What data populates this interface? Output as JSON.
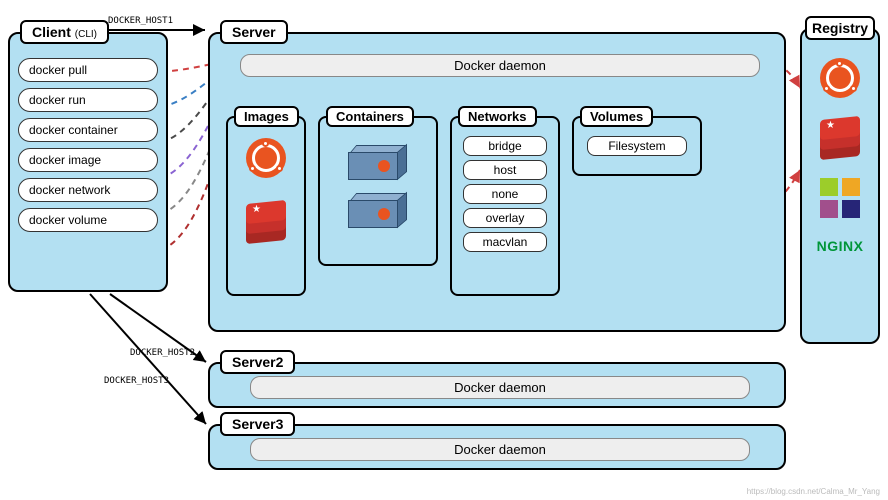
{
  "chart_data": {
    "type": "diagram",
    "nodes": {
      "client": {
        "title": "Client",
        "subtitle": "(CLI)",
        "commands": [
          "docker pull",
          "docker run",
          "docker container",
          "docker image",
          "docker network",
          "docker volume"
        ]
      },
      "server": {
        "title": "Server",
        "daemon": "Docker daemon",
        "images": {
          "title": "Images",
          "items": [
            "ubuntu",
            "redis"
          ]
        },
        "containers": {
          "title": "Containers",
          "items": [
            "container-1",
            "container-2"
          ]
        },
        "networks": {
          "title": "Networks",
          "items": [
            "bridge",
            "host",
            "none",
            "overlay",
            "macvlan"
          ]
        },
        "volumes": {
          "title": "Volumes",
          "items": [
            "Filesystem"
          ]
        }
      },
      "server2": {
        "title": "Server2",
        "daemon": "Docker daemon"
      },
      "server3": {
        "title": "Server3",
        "daemon": "Docker daemon"
      },
      "registry": {
        "title": "Registry",
        "items": [
          "ubuntu",
          "redis",
          "centos",
          "nginx"
        ],
        "nginx_text": "NGINX"
      }
    },
    "edges": [
      {
        "from": "client",
        "to": "server",
        "label": "DOCKER_HOST1",
        "style": "solid"
      },
      {
        "from": "client",
        "to": "server2",
        "label": "DOCKER_HOST2",
        "style": "solid"
      },
      {
        "from": "client",
        "to": "server3",
        "label": "DOCKER_HOST3",
        "style": "solid"
      },
      {
        "from": "docker pull",
        "to": "Docker daemon",
        "style": "dashed",
        "color": "#d04040"
      },
      {
        "from": "docker run",
        "to": "Docker daemon",
        "style": "dashed",
        "color": "#3a7fc4"
      },
      {
        "from": "docker container",
        "to": "Docker daemon",
        "style": "dashed",
        "color": "#4a4a4a"
      },
      {
        "from": "docker image",
        "to": "Docker daemon",
        "style": "dashed",
        "color": "#8a63d2"
      },
      {
        "from": "docker network",
        "to": "Docker daemon",
        "style": "dashed",
        "color": "#888"
      },
      {
        "from": "docker volume",
        "to": "Docker daemon",
        "style": "dashed",
        "color": "#b03030"
      },
      {
        "from": "Docker daemon",
        "to": "Images",
        "style": "dashed",
        "color": "#d04040"
      },
      {
        "from": "Docker daemon",
        "to": "Containers",
        "style": "dashed",
        "color": "#3a7fc4"
      },
      {
        "from": "Docker daemon",
        "to": "Networks",
        "style": "dashed",
        "color": "#888"
      },
      {
        "from": "Docker daemon",
        "to": "Volumes",
        "style": "dashed",
        "color": "#b03030"
      },
      {
        "from": "Docker daemon",
        "to": "Registry",
        "style": "dashed",
        "color": "#d04040"
      },
      {
        "from": "Images",
        "to": "Containers",
        "style": "dashed",
        "color": "#b030d0"
      },
      {
        "from": "Images",
        "to": "Registry.redis",
        "style": "dashed",
        "color": "#d04040"
      }
    ]
  },
  "watermark": "https://blog.csdn.net/Calma_Mr_Yang"
}
